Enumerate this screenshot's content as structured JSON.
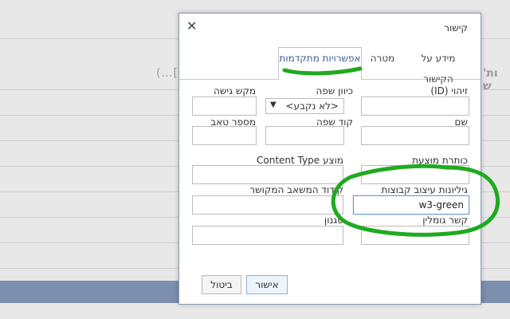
{
  "background": {
    "fragment_left": "(…[",
    "fragment_right": "ות' ש"
  },
  "dialog": {
    "title": "קישור",
    "close_glyph": "✕",
    "tabs": [
      {
        "label": "מידע על הקישור",
        "active": false
      },
      {
        "label": "מטרה",
        "active": false
      },
      {
        "label": "אפשרויות מתקדמות",
        "active": true
      }
    ],
    "fields": {
      "id_label": "זיהוי (ID)",
      "lang_dir_label": "כיוון שפה",
      "lang_dir_value": "<לא נקבע>",
      "access_key_label": "מקש גישה",
      "name_label": "שם",
      "lang_code_label": "קוד שפה",
      "tab_index_label": "מספר טאב",
      "advisory_title_label": "כותרת מוצעת",
      "content_type_label": "Content Type מוצע",
      "stylesheet_classes_label": "גיליונות עיצוב קבוצות",
      "stylesheet_classes_value": "w3-green",
      "linked_resource_charset_label": "קידוד המשאב המקושר",
      "relationship_label": "קשר גומלין",
      "style_label": "סגנון"
    },
    "buttons": {
      "ok": "אישור",
      "cancel": "ביטול"
    }
  },
  "colors": {
    "annotation_green": "#1faa1f",
    "accent_blue": "#3a5a99",
    "background_bar": "#7d8fae"
  }
}
